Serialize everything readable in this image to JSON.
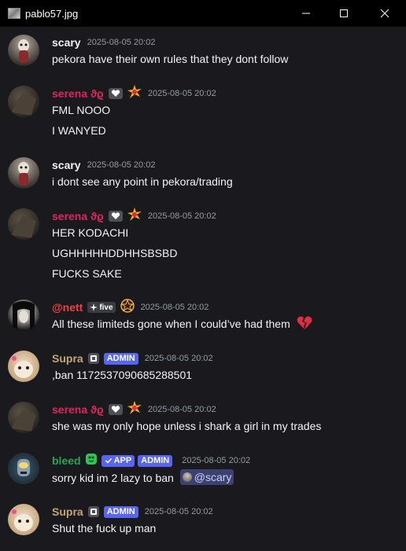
{
  "window": {
    "title": "pablo57.jpg"
  },
  "badges": {
    "admin": "ADMIN",
    "app": "APP",
    "five": "five"
  },
  "messages": [
    {
      "user": "scary",
      "time": "2025-08-05 20:02",
      "lines": [
        "pekora have their own rules that they dont follow"
      ]
    },
    {
      "user": "serena ϑϱ",
      "time": "2025-08-05 20:02",
      "lines": [
        "FML NOOO",
        "I WANYED"
      ]
    },
    {
      "user": "scary",
      "time": "2025-08-05 20:02",
      "lines": [
        "i dont see any point in pekora/trading"
      ]
    },
    {
      "user": "serena ϑϱ",
      "time": "2025-08-05 20:02",
      "lines": [
        "HER KODACHI",
        "UGHHHHHDDHHSBSBD",
        "FUCKS SAKE"
      ]
    },
    {
      "user": "@nett",
      "time": "2025-08-05 20:02",
      "lines": [
        "All these limiteds gone when I could’ve had them"
      ]
    },
    {
      "user": "Supra",
      "time": "2025-08-05 20:02",
      "lines": [
        ",ban 1172537090685288501"
      ]
    },
    {
      "user": "serena ϑϱ",
      "time": "2025-08-05 20:02",
      "lines": [
        "she was my only hope unless i shark a girl in my trades"
      ]
    },
    {
      "user": "bleed",
      "time": "2025-08-05 20:02",
      "lines": [
        "sorry kid im 2 lazy to ban"
      ],
      "mention": "@scary"
    },
    {
      "user": "Supra",
      "time": "2025-08-05 20:02",
      "lines": [
        "Shut the fuck up man"
      ]
    }
  ],
  "colors": {
    "scary": "#f2f3f5",
    "serena": "#e0245e",
    "nett": "#f23f43",
    "supra": "#c2a677",
    "bleed": "#23a559",
    "admin": "#5865f2"
  },
  "icons": {
    "app_icon": "image-file-icon",
    "minimize": "minimize-icon",
    "maximize": "maximize-icon",
    "close": "close-icon",
    "heart_box": "white-heart-badge-icon",
    "sparkle": "sparkle-burst-icon",
    "broken_heart": "broken-heart-icon",
    "pentagram": "pentagram-badge-icon",
    "check": "check-icon"
  }
}
